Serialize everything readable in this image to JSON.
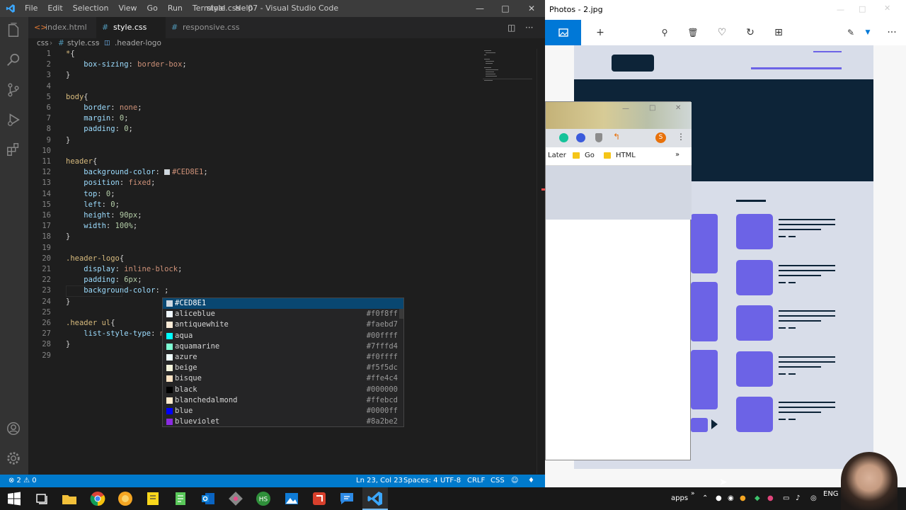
{
  "vscode": {
    "menu": [
      "File",
      "Edit",
      "Selection",
      "View",
      "Go",
      "Run",
      "Terminal",
      "Help"
    ],
    "window_title": "style.css - 07 - Visual Studio Code",
    "tabs": [
      {
        "label": "index.html"
      },
      {
        "label": "style.css"
      },
      {
        "label": "responsive.css"
      }
    ],
    "breadcrumb": {
      "folder": "css",
      "file": "style.css",
      "symbol": ".header-logo"
    },
    "lines": [
      {
        "n": "1",
        "t": "*{"
      },
      {
        "n": "2",
        "t": "    box-sizing: border-box;"
      },
      {
        "n": "3",
        "t": "}"
      },
      {
        "n": "4",
        "t": ""
      },
      {
        "n": "5",
        "t": "body{"
      },
      {
        "n": "6",
        "t": "    border: none;"
      },
      {
        "n": "7",
        "t": "    margin: 0;"
      },
      {
        "n": "8",
        "t": "    padding: 0;"
      },
      {
        "n": "9",
        "t": "}"
      },
      {
        "n": "10",
        "t": ""
      },
      {
        "n": "11",
        "t": "header{"
      },
      {
        "n": "12",
        "t": "    background-color: #CED8E1;"
      },
      {
        "n": "13",
        "t": "    position: fixed;"
      },
      {
        "n": "14",
        "t": "    top: 0;"
      },
      {
        "n": "15",
        "t": "    left: 0;"
      },
      {
        "n": "16",
        "t": "    height: 90px;"
      },
      {
        "n": "17",
        "t": "    width: 100%;"
      },
      {
        "n": "18",
        "t": "}"
      },
      {
        "n": "19",
        "t": ""
      },
      {
        "n": "20",
        "t": ".header-logo{"
      },
      {
        "n": "21",
        "t": "    display: inline-block;"
      },
      {
        "n": "22",
        "t": "    padding: 6px;"
      },
      {
        "n": "23",
        "t": "    background-color: ;"
      },
      {
        "n": "24",
        "t": "}"
      },
      {
        "n": "25",
        "t": ""
      },
      {
        "n": "26",
        "t": ".header ul{"
      },
      {
        "n": "27",
        "t": "    list-style-type: n"
      },
      {
        "n": "28",
        "t": "}"
      },
      {
        "n": "29",
        "t": ""
      }
    ],
    "suggestions": [
      {
        "name": "#CED8E1",
        "hex": "",
        "color": "#CED8E1"
      },
      {
        "name": "aliceblue",
        "hex": "#f0f8ff",
        "color": "#f0f8ff"
      },
      {
        "name": "antiquewhite",
        "hex": "#faebd7",
        "color": "#faebd7"
      },
      {
        "name": "aqua",
        "hex": "#00ffff",
        "color": "#00ffff"
      },
      {
        "name": "aquamarine",
        "hex": "#7fffd4",
        "color": "#7fffd4"
      },
      {
        "name": "azure",
        "hex": "#f0ffff",
        "color": "#f0ffff"
      },
      {
        "name": "beige",
        "hex": "#f5f5dc",
        "color": "#f5f5dc"
      },
      {
        "name": "bisque",
        "hex": "#ffe4c4",
        "color": "#ffe4c4"
      },
      {
        "name": "black",
        "hex": "#000000",
        "color": "#000000"
      },
      {
        "name": "blanchedalmond",
        "hex": "#ffebcd",
        "color": "#ffebcd"
      },
      {
        "name": "blue",
        "hex": "#0000ff",
        "color": "#0000ff"
      },
      {
        "name": "blueviolet",
        "hex": "#8a2be2",
        "color": "#8a2be2"
      }
    ],
    "status": {
      "problems": "⊗ 2 ⚠ 0",
      "position": "Ln 23, Col 23",
      "spaces": "Spaces: 4",
      "encoding": "UTF-8",
      "eol": "CRLF",
      "language": "CSS"
    }
  },
  "photos": {
    "title": "Photos - 2.jpg",
    "chrome": {
      "bookmarks": [
        "Later",
        "Go",
        "HTML"
      ],
      "profile_initial": "S"
    }
  },
  "taskbar": {
    "tray_apps": "apps",
    "lang": "ENG"
  },
  "colors": {
    "accent": "#007acc",
    "dark_navy": "#0d2438",
    "purple": "#6c63e6"
  }
}
